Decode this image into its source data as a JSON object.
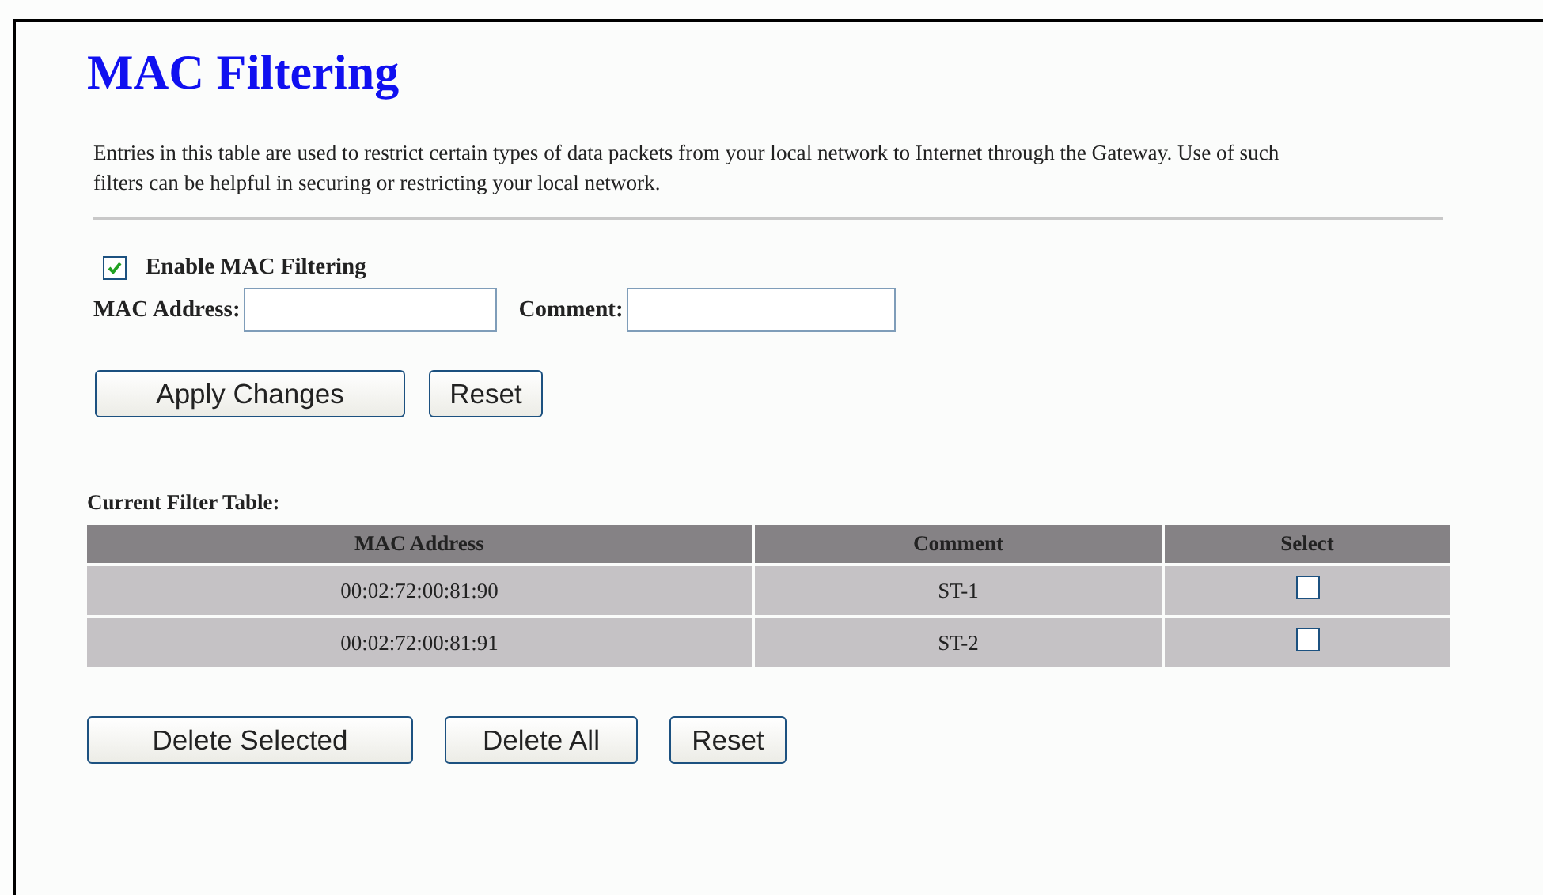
{
  "title": "MAC Filtering",
  "description": "Entries in this table are used to restrict certain types of data packets from your local network to Internet through the Gateway. Use of such filters can be helpful in securing or restricting your local network.",
  "enable": {
    "label": "Enable MAC Filtering",
    "checked": true
  },
  "fields": [
    {
      "label": "MAC Address:"
    },
    {
      "label": "Comment:"
    }
  ],
  "form_buttons": [
    "Apply Changes",
    "Reset"
  ],
  "table": {
    "caption": "Current Filter Table:",
    "columns": [
      "MAC Address",
      "Comment",
      "Select"
    ],
    "rows": [
      {
        "mac": "00:02:72:00:81:90",
        "comment": "ST-1",
        "checked": false
      },
      {
        "mac": "00:02:72:00:81:91",
        "comment": "ST-2",
        "checked": false
      }
    ]
  },
  "table_buttons": [
    "Delete Selected",
    "Delete All",
    "Reset"
  ]
}
